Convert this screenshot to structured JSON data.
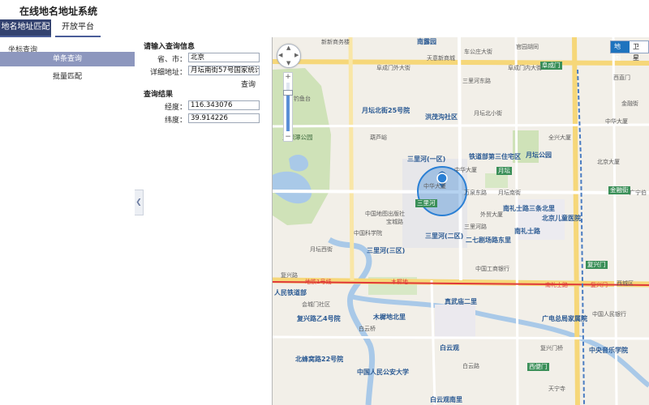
{
  "app": {
    "title": "在线地名地址系统"
  },
  "tabs": [
    {
      "label": "地名地址匹配"
    },
    {
      "label": "开放平台"
    }
  ],
  "sidebar": {
    "heading": "坐标查询",
    "items": [
      {
        "label": "单条查询"
      },
      {
        "label": "批量匹配"
      }
    ]
  },
  "form": {
    "input_title": "请输入查询信息",
    "province_label": "省、市：",
    "province_value": "北京",
    "address_label": "详细地址：",
    "address_value": "月坛南街57号国家统计局",
    "query_button": "查询",
    "result_title": "查询结果",
    "lng_label": "经度：",
    "lng_value": "116.343076",
    "lat_label": "纬度：",
    "lat_value": "39.914226"
  },
  "map": {
    "type_buttons": [
      {
        "label": "地图"
      },
      {
        "label": "卫星"
      }
    ],
    "zoom_level": 0.8,
    "colors": {
      "marker": "#2a7fd4",
      "metro_red": "#e03a3a",
      "water": "#a9c9e8",
      "park": "#cfe2b8"
    },
    "icons": [
      "pan-control-icon",
      "zoom-in-icon",
      "zoom-out-icon",
      "location-marker-icon",
      "collapse-arrow-icon"
    ],
    "labels": {
      "l1": "南露园",
      "l2": "新新商务楼",
      "l3": "天意新商城",
      "l4": "官园胡同",
      "l5": "车公庄大街",
      "l6": "阜成门",
      "l7": "阜成门内大街",
      "l8": "阜成门外大街",
      "l9": "月坛北街25号院",
      "l10": "洪茂沟社区",
      "l11": "三里河东路",
      "l12": "月坛北小街",
      "l13": "铁道部第三住宅区",
      "l14": "月坛公园",
      "l15": "三里河(一区)",
      "l16": "月坛",
      "l17": "金融街",
      "l18": "月坛南街",
      "l19": "三里河",
      "l20": "南礼士路三条北里",
      "l21": "北京儿童医院",
      "l22": "南礼士路",
      "l23": "三里河(三区)",
      "l24": "三里河(二区)",
      "l25": "二七剧场路东里",
      "l26": "复兴门",
      "l27": "地铁1号线",
      "l28": "木樨地",
      "l29": "南礼士路",
      "l30": "复兴门",
      "l31": "真武庙二里",
      "l32": "广电总局家属院",
      "l33": "复兴路乙4号院",
      "l34": "木樨地北里",
      "l35": "白云观",
      "l36": "北蜂窝路22号院",
      "l37": "中国人民公安大学",
      "l38": "西便门",
      "l39": "中央音乐学院",
      "l40": "白云观南里",
      "l41": "中华大厦",
      "l42": "外贸大厦",
      "l43": "钓鱼台",
      "l44": "玉渊潭公园",
      "l45": "中国地图出版社",
      "l46": "中国科学院",
      "l47": "复兴路",
      "l48": "人民铁道部",
      "l49": "会城门社区",
      "l50": "西城区",
      "l51": "中国人民银行",
      "l52": "天宁寺",
      "l53": "宝城路",
      "l54": "万泉东路",
      "l55": "广宁伯",
      "l56": "全兴大厦",
      "l57": "中华大厦",
      "l58": "金融街",
      "l59": "北京大厦",
      "l60": "西直门",
      "l61": "葫芦峪",
      "l62": "中华大厦",
      "l63": "白云桥",
      "l64": "白云路",
      "l65": "复兴门桥",
      "l66": "中国工商银行",
      "l67": "月坛西街",
      "l68": "三里河路"
    }
  }
}
